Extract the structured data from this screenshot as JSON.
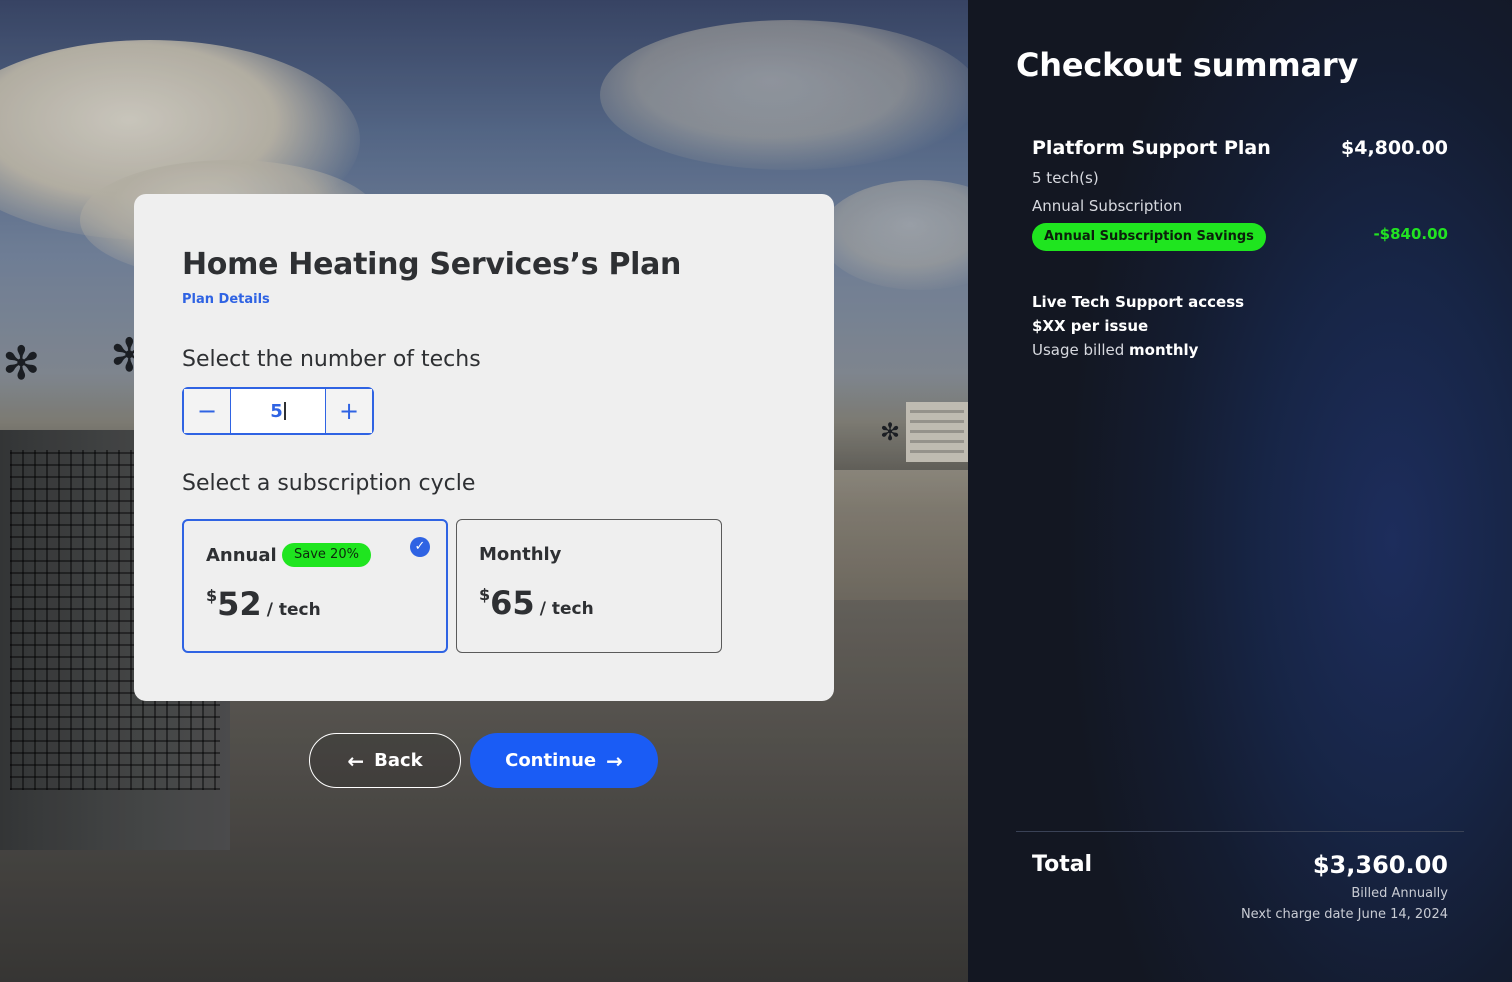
{
  "plan": {
    "title": "Home Heating Services’s Plan",
    "details_link": "Plan Details",
    "techs_label": "Select the number of techs",
    "tech_count": "5",
    "minus_symbol": "−",
    "plus_symbol": "+",
    "cycle_label": "Select a subscription cycle"
  },
  "cycles": {
    "annual": {
      "name": "Annual",
      "badge": "Save 20%",
      "currency": "$",
      "price": "52",
      "per": "/ tech",
      "selected": true
    },
    "monthly": {
      "name": "Monthly",
      "currency": "$",
      "price": "65",
      "per": "/ tech",
      "selected": false
    }
  },
  "actions": {
    "back_label": "Back",
    "back_icon": "arrow-left-icon",
    "continue_label": "Continue",
    "continue_icon": "arrow-right-icon"
  },
  "summary": {
    "title": "Checkout summary",
    "item_name": "Platform Support Plan",
    "item_price": "$4,800.00",
    "item_techs": "5 tech(s)",
    "item_cycle": "Annual Subscription",
    "savings_label": "Annual Subscription Savings",
    "savings_amount": "-$840.00",
    "live_title": "Live Tech Support access",
    "live_price": "$XX per issue",
    "live_usage_prefix": "Usage billed ",
    "live_usage_period": "monthly",
    "total_label": "Total",
    "total_amount": "$3,360.00",
    "billed": "Billed Annually",
    "next_charge": "Next charge date June 14, 2024"
  },
  "colors": {
    "accent": "#1a5cf5",
    "link": "#2f63e3",
    "badge_green": "#1fe51f",
    "panel_bg": "#141c30"
  }
}
